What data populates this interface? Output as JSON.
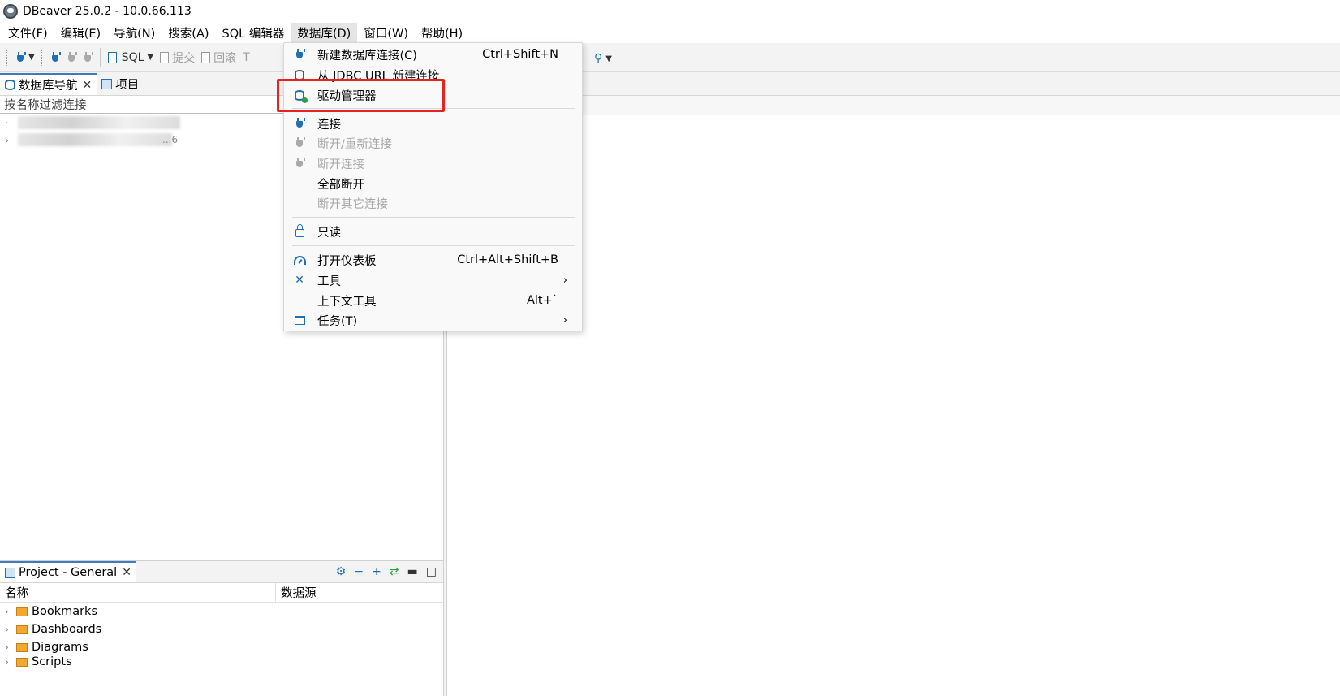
{
  "window": {
    "title": "DBeaver 25.0.2 - 10.0.66.113"
  },
  "menubar": [
    {
      "label": "文件(F)"
    },
    {
      "label": "编辑(E)"
    },
    {
      "label": "导航(N)"
    },
    {
      "label": "搜索(A)"
    },
    {
      "label": "SQL 编辑器"
    },
    {
      "label": "数据库(D)"
    },
    {
      "label": "窗口(W)"
    },
    {
      "label": "帮助(H)"
    }
  ],
  "toolbar": {
    "sql_label": "SQL",
    "commit_label": "提交",
    "rollback_label": "回滚",
    "partial_label": "T"
  },
  "navigator": {
    "tab_label": "数据库导航",
    "projects_tab_label": "项目",
    "filter_placeholder": "按名称过滤连接",
    "tree_partial_text": "...6"
  },
  "project_panel": {
    "tab_label": "Project - General",
    "columns": [
      "名称",
      "数据源"
    ],
    "items": [
      {
        "label": "Bookmarks",
        "icon": "bookmarks-folder-icon"
      },
      {
        "label": "Dashboards",
        "icon": "dashboards-folder-icon"
      },
      {
        "label": "Diagrams",
        "icon": "diagrams-folder-icon"
      },
      {
        "label": "Scripts",
        "icon": "scripts-folder-icon"
      }
    ]
  },
  "database_menu": {
    "items": [
      {
        "label": "新建数据库连接(C)",
        "shortcut": "Ctrl+Shift+N",
        "icon": "new-connection-icon",
        "enabled": true
      },
      {
        "label": "从 JDBC URL 新建连接",
        "shortcut": "",
        "icon": "database-icon",
        "enabled": true
      },
      {
        "label": "驱动管理器",
        "shortcut": "",
        "icon": "driver-manager-icon",
        "enabled": true,
        "highlighted": true
      },
      {
        "label": "连接",
        "shortcut": "",
        "icon": "connect-icon",
        "enabled": true
      },
      {
        "label": "断开/重新连接",
        "shortcut": "",
        "icon": "reconnect-icon",
        "enabled": false
      },
      {
        "label": "断开连接",
        "shortcut": "",
        "icon": "disconnect-icon",
        "enabled": false
      },
      {
        "label": "全部断开",
        "shortcut": "",
        "icon": "",
        "enabled": true
      },
      {
        "label": "断开其它连接",
        "shortcut": "",
        "icon": "",
        "enabled": false
      },
      {
        "label": "只读",
        "shortcut": "",
        "icon": "lock-icon",
        "enabled": true
      },
      {
        "label": "打开仪表板",
        "shortcut": "Ctrl+Alt+Shift+B",
        "icon": "dashboard-icon",
        "enabled": true
      },
      {
        "label": "工具",
        "shortcut": "",
        "icon": "tools-icon",
        "enabled": true,
        "submenu": true
      },
      {
        "label": "上下文工具",
        "shortcut": "Alt+`",
        "icon": "",
        "enabled": true
      },
      {
        "label": "任务(T)",
        "shortcut": "",
        "icon": "tasks-icon",
        "enabled": true,
        "submenu": true
      }
    ]
  },
  "colors": {
    "accent": "#1f6fb2",
    "highlight_border": "#e8231d",
    "folder": "#f0a830"
  }
}
